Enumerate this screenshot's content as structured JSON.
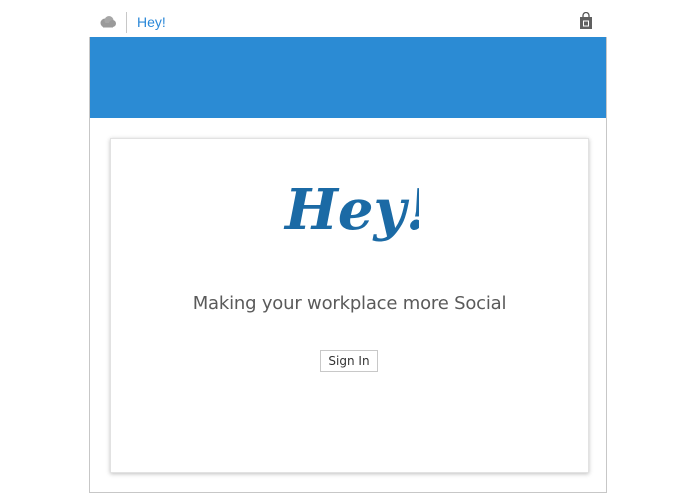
{
  "titlebar": {
    "app_name": "Hey!",
    "cloud_icon": "cloud-icon",
    "store_icon": "shopping-bag-icon"
  },
  "colors": {
    "banner": "#2b8bd4",
    "accent": "#2b88d8",
    "logo": "#1b6aa5"
  },
  "card": {
    "logo_text": "Hey!",
    "tagline": "Making your workplace more Social",
    "signin_label": "Sign In"
  }
}
